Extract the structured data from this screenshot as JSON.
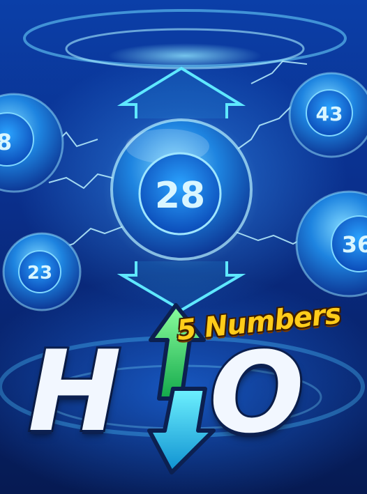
{
  "game": {
    "balls": {
      "center": "28",
      "top_right": "43",
      "left": "23",
      "right_partial": "36",
      "left_partial": "8"
    },
    "logo": {
      "subtitle": "5 Numbers",
      "letter_h": "H",
      "letter_o": "O"
    },
    "colors": {
      "up_arrow": "#3ee06a",
      "down_arrow": "#1ec8ee",
      "subtitle": "#ffcc1a"
    },
    "icons": [
      "up-arrow-icon",
      "down-arrow-icon"
    ]
  }
}
